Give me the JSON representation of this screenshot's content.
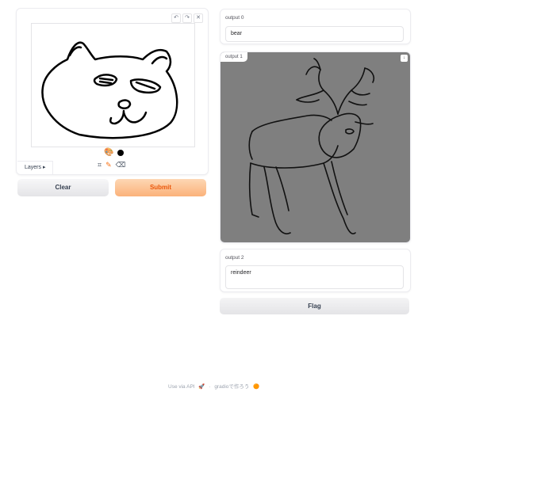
{
  "input": {
    "layers_label": "Layers",
    "layers_caret": "▸",
    "tool_icons": [
      "↶",
      "↷",
      "✕"
    ],
    "palette_icon": "🎨",
    "toolbar_icons": [
      "⌗",
      "✎",
      "⌫"
    ]
  },
  "actions": {
    "clear_label": "Clear",
    "submit_label": "Submit",
    "flag_label": "Flag"
  },
  "outputs": {
    "out0_label": "output 0",
    "out0_value": "bear",
    "out1_label": "output 1",
    "out2_label": "output 2",
    "out2_value": "reindeer"
  },
  "footer": {
    "api_text": "Use via API",
    "api_icon": "🚀",
    "separator": "·",
    "built_with": "gradioで作ろう",
    "logo_icon": "🟠"
  }
}
